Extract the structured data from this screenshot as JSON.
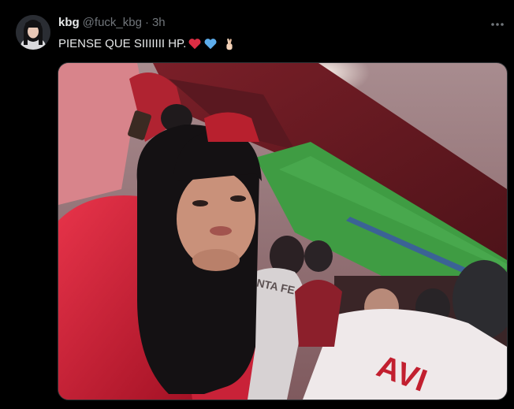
{
  "tweet": {
    "display_name": "kbg",
    "handle": "@fuck_kbg",
    "separator": "·",
    "time": "3h",
    "text": "PIENSE QUE SIIIIIII HP.",
    "emojis": [
      "red-heart",
      "blue-heart",
      "fingers-crossed"
    ],
    "more_icon": "more-horizontal-icon",
    "photo": {
      "subject": "selfie-in-stadium",
      "shirt_texts": [
        "SANTA FE",
        "AVI"
      ]
    }
  },
  "colors": {
    "background": "#000000",
    "name": "#e7e9ea",
    "secondary": "#71767b",
    "border": "#2f3336"
  }
}
